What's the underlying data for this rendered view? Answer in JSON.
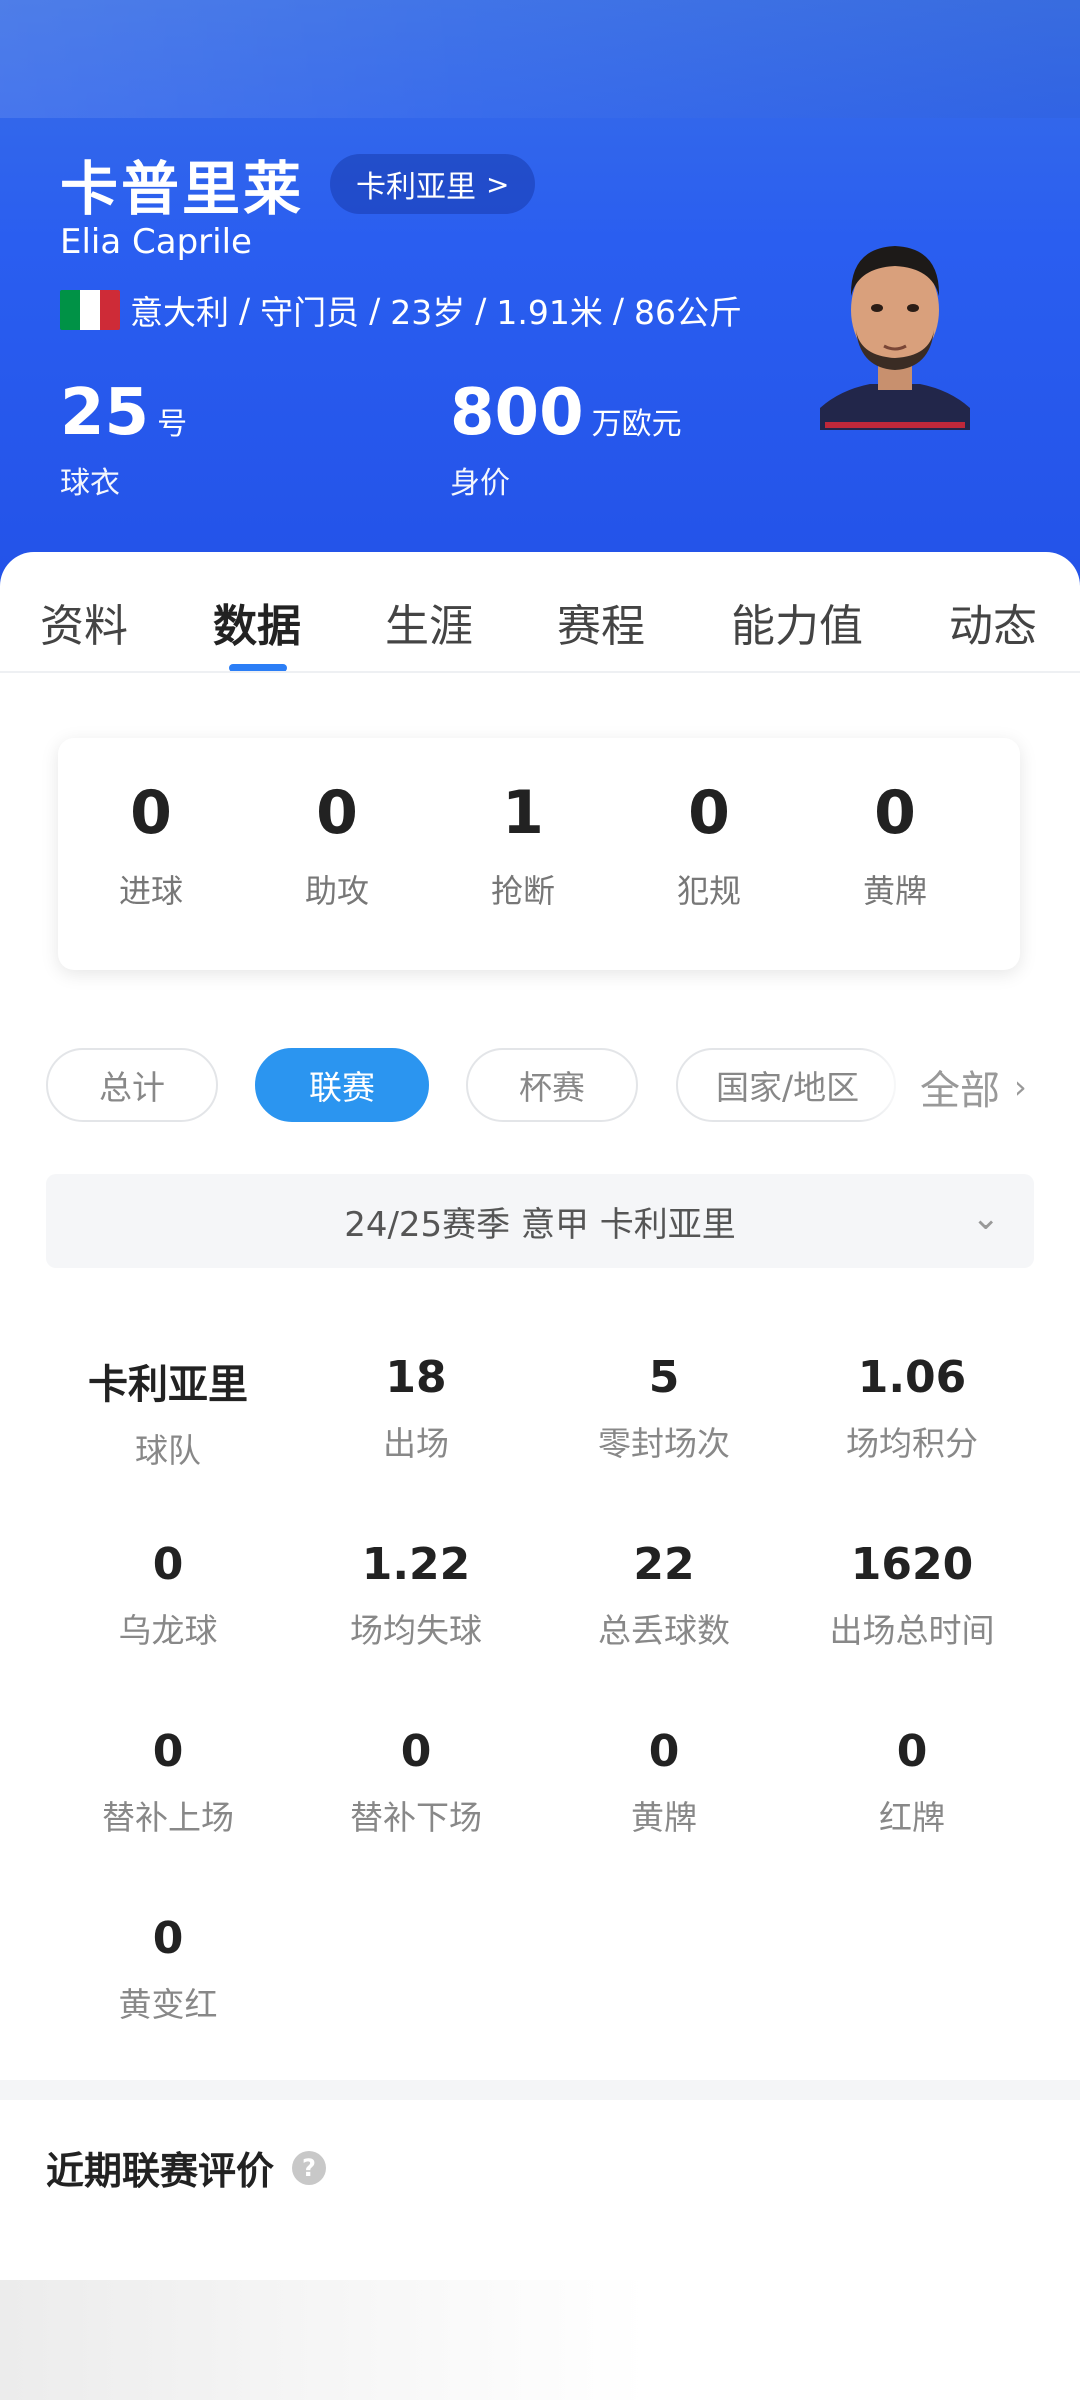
{
  "player": {
    "name": "卡普里莱",
    "team_link": "卡利亚里",
    "en_name": "Elia Caprile",
    "flag_colors": [
      "#009246",
      "#ffffff",
      "#ce2b37"
    ],
    "nationality": "意大利",
    "position": "守门员",
    "age": "23岁",
    "height": "1.91米",
    "weight": "86公斤",
    "jersey_number": "25",
    "jersey_unit": "号",
    "jersey_label": "球衣",
    "market_value": "800",
    "value_unit": "万欧元",
    "value_label": "身价"
  },
  "tabs": [
    {
      "label": "资料"
    },
    {
      "label": "数据",
      "active": true
    },
    {
      "label": "生涯"
    },
    {
      "label": "赛程"
    },
    {
      "label": "能力值"
    },
    {
      "label": "动态"
    }
  ],
  "summary": [
    {
      "value": "0",
      "label": "进球"
    },
    {
      "value": "0",
      "label": "助攻"
    },
    {
      "value": "1",
      "label": "抢断"
    },
    {
      "value": "0",
      "label": "犯规"
    },
    {
      "value": "0",
      "label": "黄牌"
    }
  ],
  "filters": {
    "chips": [
      {
        "label": "总计"
      },
      {
        "label": "联赛",
        "active": true
      },
      {
        "label": "杯赛"
      },
      {
        "label": "国家/地区"
      }
    ],
    "more_label": "全部"
  },
  "season_select": {
    "value": "24/25赛季 意甲 卡利亚里"
  },
  "stats": [
    {
      "value": "卡利亚里",
      "label": "球队"
    },
    {
      "value": "18",
      "label": "出场"
    },
    {
      "value": "5",
      "label": "零封场次"
    },
    {
      "value": "1.06",
      "label": "场均积分"
    },
    {
      "value": "0",
      "label": "乌龙球"
    },
    {
      "value": "1.22",
      "label": "场均失球"
    },
    {
      "value": "22",
      "label": "总丢球数"
    },
    {
      "value": "1620",
      "label": "出场总时间"
    },
    {
      "value": "0",
      "label": "替补上场"
    },
    {
      "value": "0",
      "label": "替补下场"
    },
    {
      "value": "0",
      "label": "黄牌"
    },
    {
      "value": "0",
      "label": "红牌"
    },
    {
      "value": "0",
      "label": "黄变红"
    }
  ],
  "recent": {
    "title": "近期联赛评价",
    "help_icon": "?"
  },
  "colors": {
    "header_blue": "#2a5ef0",
    "accent_blue": "#2b95f0",
    "tab_indicator": "#2b7ef6"
  }
}
